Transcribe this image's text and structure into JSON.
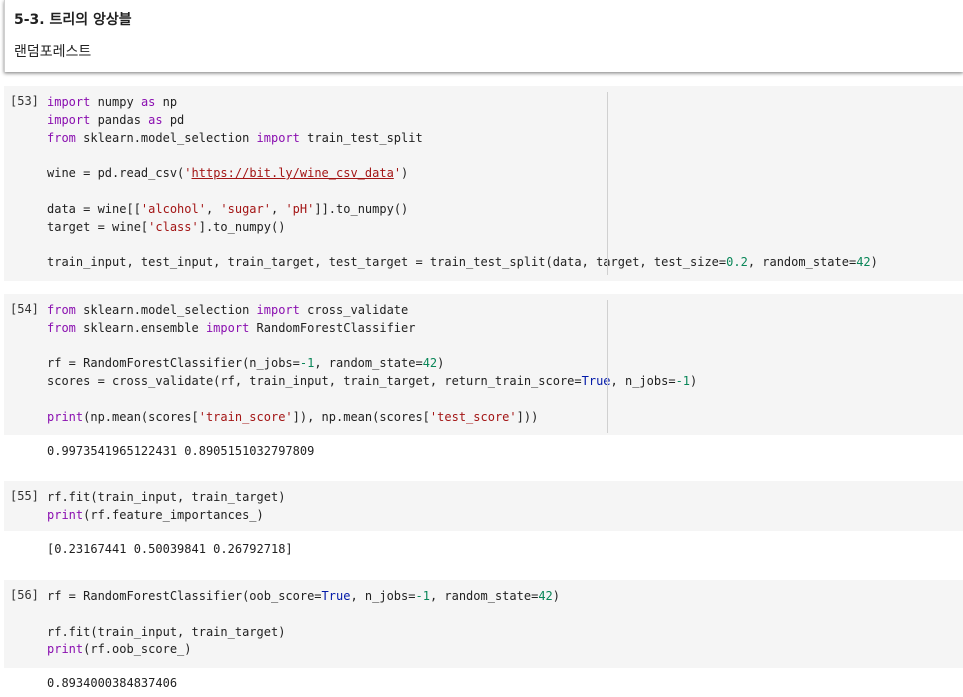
{
  "text_cell": {
    "heading": "5-3. 트리의 앙상블",
    "subtext": "랜덤포레스트"
  },
  "cells": [
    {
      "count": "[53]",
      "lines": [
        [
          [
            "kw",
            "import"
          ],
          [
            "t",
            " numpy "
          ],
          [
            "kw",
            "as"
          ],
          [
            "t",
            " np"
          ]
        ],
        [
          [
            "kw",
            "import"
          ],
          [
            "t",
            " pandas "
          ],
          [
            "kw",
            "as"
          ],
          [
            "t",
            " pd"
          ]
        ],
        [
          [
            "kw",
            "from"
          ],
          [
            "t",
            " sklearn.model_selection "
          ],
          [
            "kw",
            "import"
          ],
          [
            "t",
            " train_test_split"
          ]
        ],
        [],
        [
          [
            "t",
            "wine = pd.read_csv("
          ],
          [
            "str",
            "'"
          ],
          [
            "url",
            "https://bit.ly/wine_csv_data"
          ],
          [
            "str",
            "'"
          ],
          [
            "t",
            ")"
          ]
        ],
        [],
        [
          [
            "t",
            "data = wine[["
          ],
          [
            "str",
            "'alcohol'"
          ],
          [
            "t",
            ", "
          ],
          [
            "str",
            "'sugar'"
          ],
          [
            "t",
            ", "
          ],
          [
            "str",
            "'pH'"
          ],
          [
            "t",
            "]].to_numpy()"
          ]
        ],
        [
          [
            "t",
            "target = wine["
          ],
          [
            "str",
            "'class'"
          ],
          [
            "t",
            "].to_numpy()"
          ]
        ],
        [],
        [
          [
            "t",
            "train_input, test_input, train_target, test_target = train_test_split(data, target, test_size="
          ],
          [
            "num",
            "0.2"
          ],
          [
            "t",
            ", random_state="
          ],
          [
            "num",
            "42"
          ],
          [
            "t",
            ")"
          ]
        ]
      ],
      "output": ""
    },
    {
      "count": "[54]",
      "lines": [
        [
          [
            "kw",
            "from"
          ],
          [
            "t",
            " sklearn.model_selection "
          ],
          [
            "kw",
            "import"
          ],
          [
            "t",
            " cross_validate"
          ]
        ],
        [
          [
            "kw",
            "from"
          ],
          [
            "t",
            " sklearn.ensemble "
          ],
          [
            "kw",
            "import"
          ],
          [
            "t",
            " RandomForestClassifier"
          ]
        ],
        [],
        [
          [
            "t",
            "rf = RandomForestClassifier(n_jobs="
          ],
          [
            "num",
            "-1"
          ],
          [
            "t",
            ", random_state="
          ],
          [
            "num",
            "42"
          ],
          [
            "t",
            ")"
          ]
        ],
        [
          [
            "t",
            "scores = cross_validate(rf, train_input, train_target, return_train_score="
          ],
          [
            "cst",
            "True"
          ],
          [
            "t",
            ", n_jobs="
          ],
          [
            "num",
            "-1"
          ],
          [
            "t",
            ")"
          ]
        ],
        [],
        [
          [
            "bi",
            "print"
          ],
          [
            "t",
            "(np.mean(scores["
          ],
          [
            "str",
            "'train_score'"
          ],
          [
            "t",
            "]), np.mean(scores["
          ],
          [
            "str",
            "'test_score'"
          ],
          [
            "t",
            "]))"
          ]
        ]
      ],
      "output": "0.9973541965122431 0.8905151032797809"
    },
    {
      "count": "[55]",
      "lines": [
        [
          [
            "t",
            "rf.fit(train_input, train_target)"
          ]
        ],
        [
          [
            "bi",
            "print"
          ],
          [
            "t",
            "(rf.feature_importances_)"
          ]
        ]
      ],
      "output": "[0.23167441 0.50039841 0.26792718]"
    },
    {
      "count": "[56]",
      "lines": [
        [
          [
            "t",
            "rf = RandomForestClassifier(oob_score="
          ],
          [
            "cst",
            "True"
          ],
          [
            "t",
            ", n_jobs="
          ],
          [
            "num",
            "-1"
          ],
          [
            "t",
            ", random_state="
          ],
          [
            "num",
            "42"
          ],
          [
            "t",
            ")"
          ]
        ],
        [],
        [
          [
            "t",
            "rf.fit(train_input, train_target)"
          ]
        ],
        [
          [
            "bi",
            "print"
          ],
          [
            "t",
            "(rf.oob_score_)"
          ]
        ]
      ],
      "output": "0.8934000384837406"
    }
  ]
}
